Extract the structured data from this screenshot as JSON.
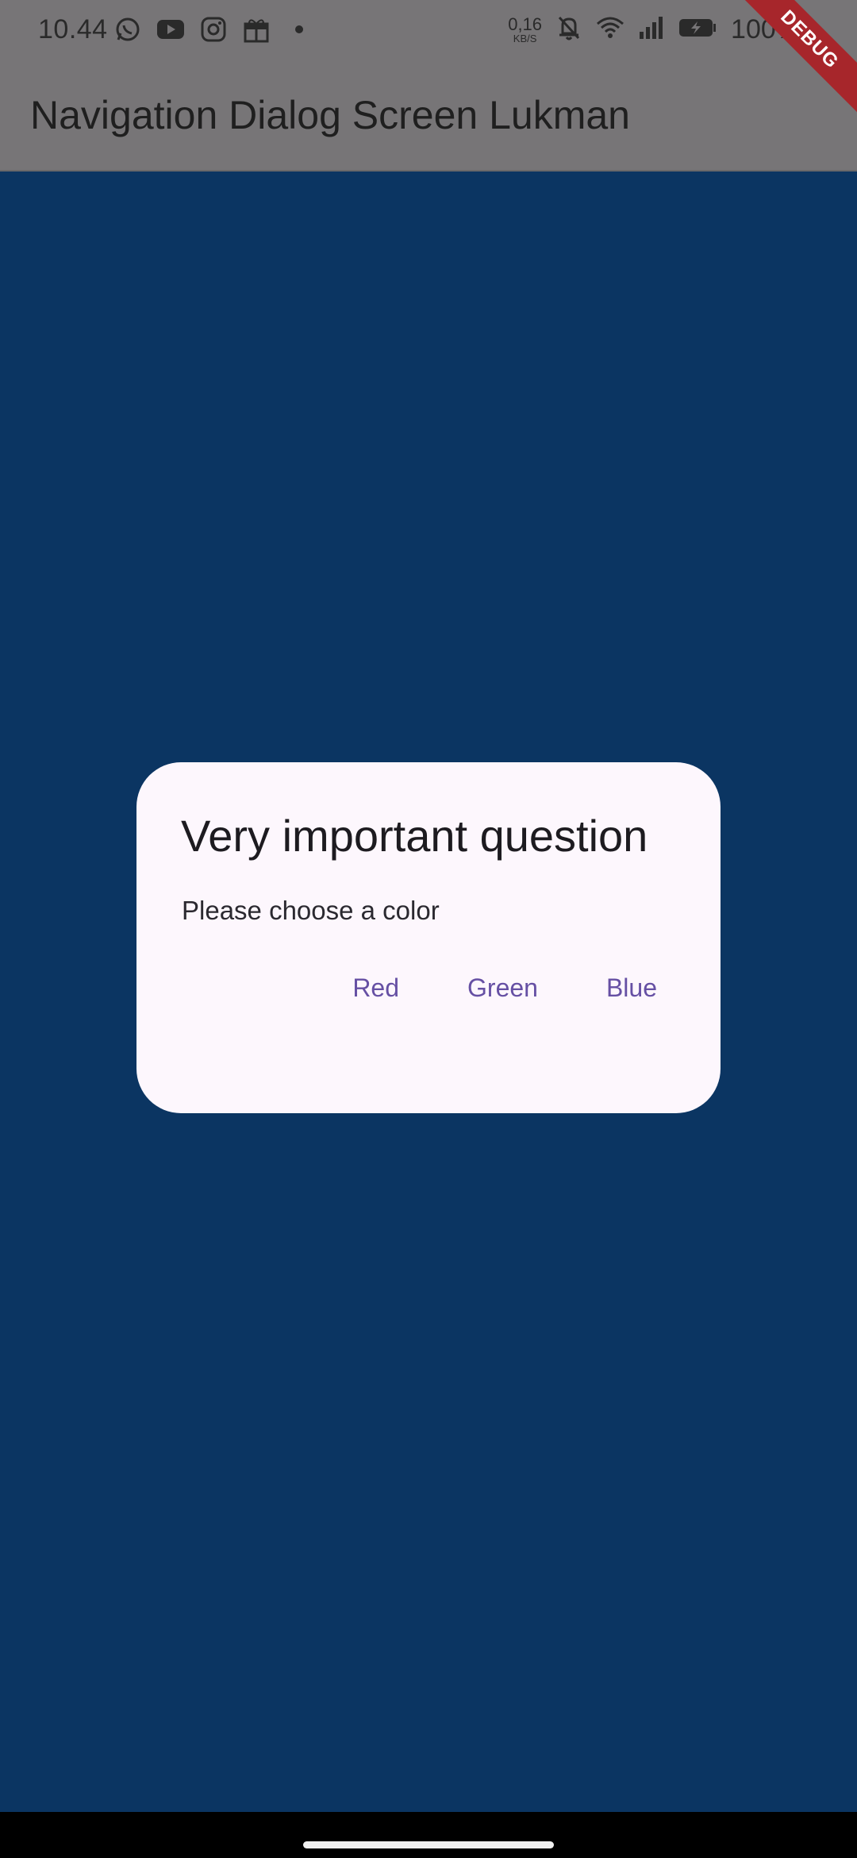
{
  "status_bar": {
    "time": "10.44",
    "net_speed_value": "0,16",
    "net_speed_unit": "KB/S",
    "battery": "100%",
    "icons_left": [
      "whatsapp-icon",
      "youtube-icon",
      "instagram-icon",
      "gift-icon",
      "dot-icon"
    ],
    "icons_right": [
      "bell-off-icon",
      "wifi-icon",
      "signal-icon",
      "battery-charging-icon"
    ]
  },
  "app_bar": {
    "title": "Navigation Dialog Screen Lukman"
  },
  "debug_banner": "DEBUG",
  "dialog": {
    "title": "Very important question",
    "content": "Please choose a color",
    "actions": [
      {
        "label": "Red"
      },
      {
        "label": "Green"
      },
      {
        "label": "Blue"
      }
    ]
  },
  "colors": {
    "background": "#0b3562",
    "dialog_bg": "#fdf7fd",
    "accent": "#6650a4",
    "scrim_app_bar": "#777577",
    "debug_ribbon": "#a7262b"
  }
}
